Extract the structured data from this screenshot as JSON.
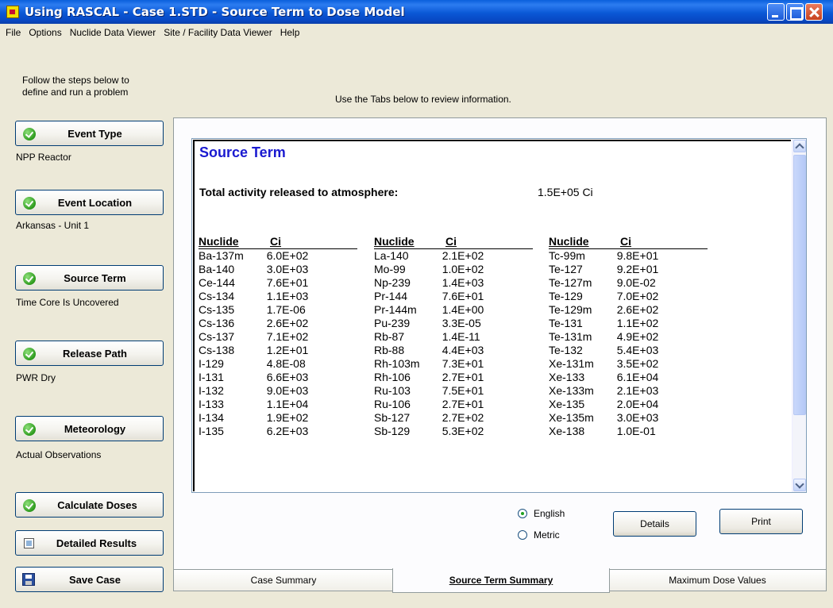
{
  "window": {
    "title": "Using RASCAL - Case 1.STD - Source Term to Dose Model"
  },
  "menu": [
    "File",
    "Options",
    "Nuclide Data Viewer",
    "Site / Facility Data Viewer",
    "Help"
  ],
  "left": {
    "intro_line1": "Follow the steps below to",
    "intro_line2": "define and run a problem",
    "steps": [
      {
        "label": "Event Type",
        "sub": "NPP Reactor"
      },
      {
        "label": "Event Location",
        "sub": "Arkansas - Unit 1"
      },
      {
        "label": "Source Term",
        "sub": "Time Core Is Uncovered"
      },
      {
        "label": "Release Path",
        "sub": "PWR Dry"
      },
      {
        "label": "Meteorology",
        "sub": "Actual Observations"
      }
    ],
    "calculate_label": "Calculate Doses",
    "detailed_label": "Detailed Results",
    "save_label": "Save Case"
  },
  "main": {
    "instruction": "Use the Tabs below to review information.",
    "report": {
      "title": "Source Term",
      "total_label": "Total activity released to atmosphere:",
      "total_value": "1.5E+05 Ci",
      "col_nuclide": "Nuclide",
      "col_ci": "Ci",
      "columns": [
        [
          [
            "Ba-137m",
            "6.0E+02"
          ],
          [
            "Ba-140",
            "3.0E+03"
          ],
          [
            "Ce-144",
            "7.6E+01"
          ],
          [
            "Cs-134",
            "1.1E+03"
          ],
          [
            "Cs-135",
            "1.7E-06"
          ],
          [
            "Cs-136",
            "2.6E+02"
          ],
          [
            "Cs-137",
            "7.1E+02"
          ],
          [
            "Cs-138",
            "1.2E+01"
          ],
          [
            "I-129",
            "4.8E-08"
          ],
          [
            "I-131",
            "6.6E+03"
          ],
          [
            "I-132",
            "9.0E+03"
          ],
          [
            "I-133",
            "1.1E+04"
          ],
          [
            "I-134",
            "1.9E+02"
          ],
          [
            "I-135",
            "6.2E+03"
          ]
        ],
        [
          [
            "La-140",
            "2.1E+02"
          ],
          [
            "Mo-99",
            "1.0E+02"
          ],
          [
            "Np-239",
            "1.4E+03"
          ],
          [
            "Pr-144",
            "7.6E+01"
          ],
          [
            "Pr-144m",
            "1.4E+00"
          ],
          [
            "Pu-239",
            "3.3E-05"
          ],
          [
            "Rb-87",
            "1.4E-11"
          ],
          [
            "Rb-88",
            "4.4E+03"
          ],
          [
            "Rh-103m",
            "7.3E+01"
          ],
          [
            "Rh-106",
            "2.7E+01"
          ],
          [
            "Ru-103",
            "7.5E+01"
          ],
          [
            "Ru-106",
            "2.7E+01"
          ],
          [
            "Sb-127",
            "2.7E+02"
          ],
          [
            "Sb-129",
            "5.3E+02"
          ]
        ],
        [
          [
            "Tc-99m",
            "9.8E+01"
          ],
          [
            "Te-127",
            "9.2E+01"
          ],
          [
            "Te-127m",
            "9.0E-02"
          ],
          [
            "Te-129",
            "7.0E+02"
          ],
          [
            "Te-129m",
            "2.6E+02"
          ],
          [
            "Te-131",
            "1.1E+02"
          ],
          [
            "Te-131m",
            "4.9E+02"
          ],
          [
            "Te-132",
            "5.4E+03"
          ],
          [
            "Xe-131m",
            "3.5E+02"
          ],
          [
            "Xe-133",
            "6.1E+04"
          ],
          [
            "Xe-133m",
            "2.1E+03"
          ],
          [
            "Xe-135",
            "2.0E+04"
          ],
          [
            "Xe-135m",
            "3.0E+03"
          ],
          [
            "Xe-138",
            "1.0E-01"
          ]
        ]
      ]
    },
    "units": {
      "english": "English",
      "metric": "Metric",
      "selected": "English"
    },
    "details_label": "Details",
    "print_label": "Print"
  },
  "tabs": [
    {
      "label": "Case Summary",
      "active": false
    },
    {
      "label": "Source Term Summary",
      "active": true
    },
    {
      "label": "Maximum Dose Values",
      "active": false
    }
  ]
}
